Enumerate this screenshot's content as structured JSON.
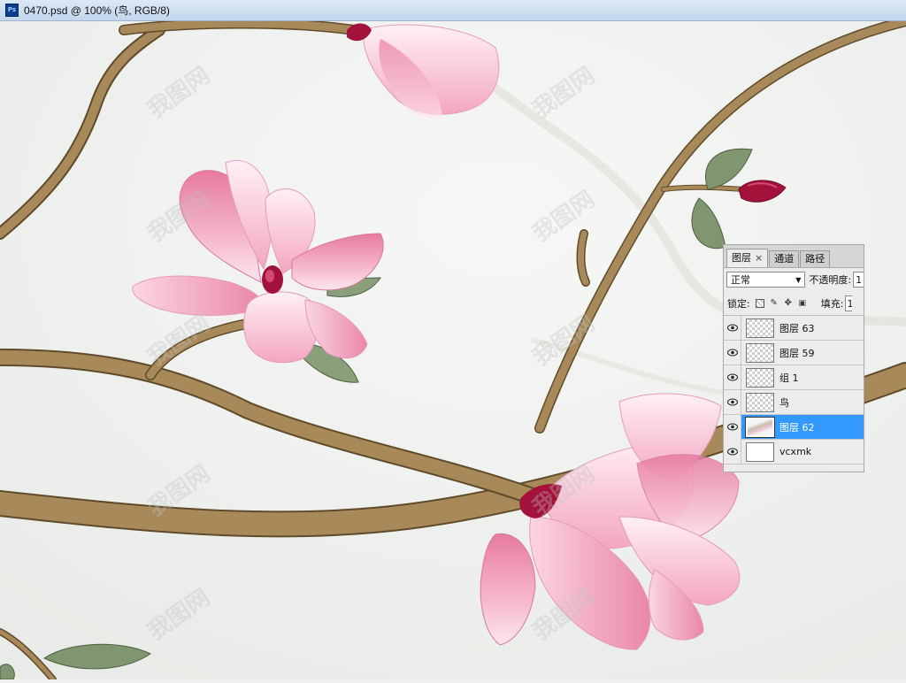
{
  "window": {
    "app_icon": "Ps",
    "title": "0470.psd @ 100% (鸟, RGB/8)"
  },
  "watermark": {
    "text": "我图网"
  },
  "layers_panel": {
    "tabs": [
      {
        "label": "图层",
        "active": true,
        "close": "×"
      },
      {
        "label": "通道",
        "active": false
      },
      {
        "label": "路径",
        "active": false
      }
    ],
    "blend_mode": "正常",
    "opacity_label": "不透明度:",
    "opacity_value": "1",
    "lock_label": "锁定:",
    "fill_label": "填充:",
    "fill_value": "1",
    "layers": [
      {
        "name": "图层 63",
        "visible": true,
        "selected": false,
        "thumb": "transparent"
      },
      {
        "name": "图层 59",
        "visible": true,
        "selected": false,
        "thumb": "transparent"
      },
      {
        "name": "组 1",
        "visible": true,
        "selected": false,
        "thumb": "transparent"
      },
      {
        "name": "鸟",
        "visible": true,
        "selected": false,
        "thumb": "transparent"
      },
      {
        "name": "图层 62",
        "visible": true,
        "selected": true,
        "thumb": "image"
      },
      {
        "name": "vcxmk",
        "visible": true,
        "selected": false,
        "thumb": "white"
      }
    ]
  },
  "colors": {
    "selection": "#3399ff",
    "branch": "#a88a5a",
    "petal": "#f2a9c4",
    "bud": "#a3123a",
    "leaf": "#7f9670"
  }
}
